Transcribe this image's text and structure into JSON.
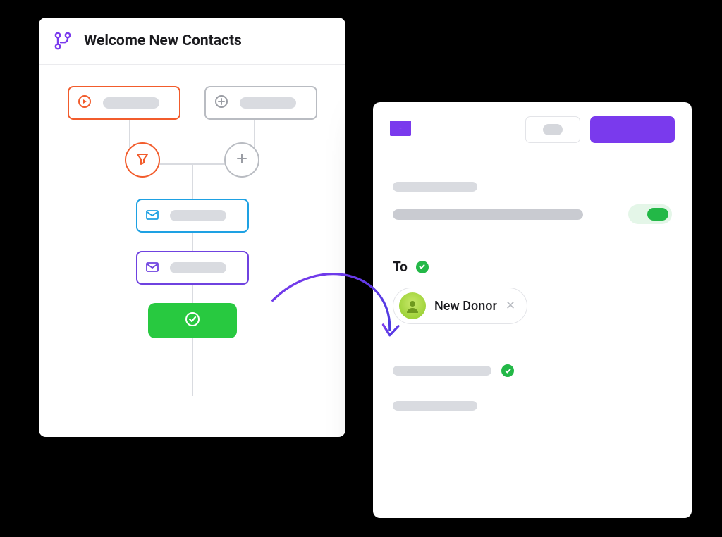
{
  "workflow": {
    "title": "Welcome New Contacts",
    "icon": "branch-icon"
  },
  "email": {
    "to_label": "To",
    "recipient": "New Donor"
  },
  "colors": {
    "purple": "#7a3aed",
    "orange": "#f25c2c",
    "blue": "#1ea1e3",
    "green": "#28c940"
  }
}
